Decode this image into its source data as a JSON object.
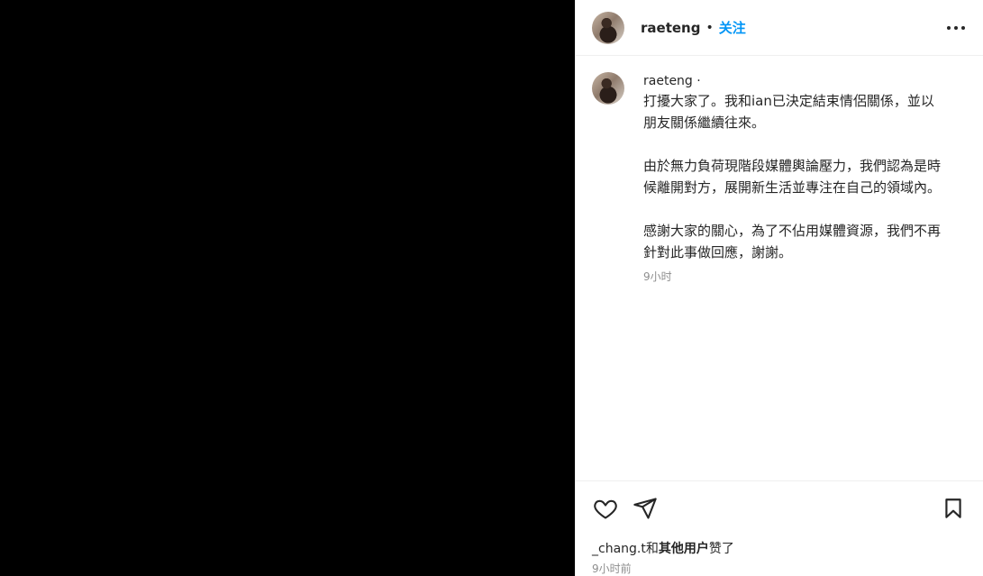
{
  "header": {
    "username": "raeteng",
    "separator": "•",
    "follow_label": "关注",
    "more_icon": "more-horizontal-icon"
  },
  "caption": {
    "username": "raeteng ·",
    "text": "打擾大家了。我和ian已決定結束情侶關係，並以\n朋友關係繼續往來。\n\n由於無力負荷現階段媒體輿論壓力，我們認為是時\n候離開對方，展開新生活並專注在自己的領域內。\n\n感謝大家的關心，為了不佔用媒體資源，我們不再\n針對此事做回應，謝謝。",
    "time": "9小时"
  },
  "actions": {
    "like_icon": "heart-icon",
    "share_icon": "send-icon",
    "save_icon": "bookmark-icon"
  },
  "likes": {
    "first_user": "_chang.t",
    "connector": "和",
    "others": "其他用户",
    "suffix": "赞了"
  },
  "post_time": "9小时前",
  "colors": {
    "media_bg": "#000000",
    "follow_blue": "#0095f6",
    "muted_text": "#8e8e8e"
  }
}
